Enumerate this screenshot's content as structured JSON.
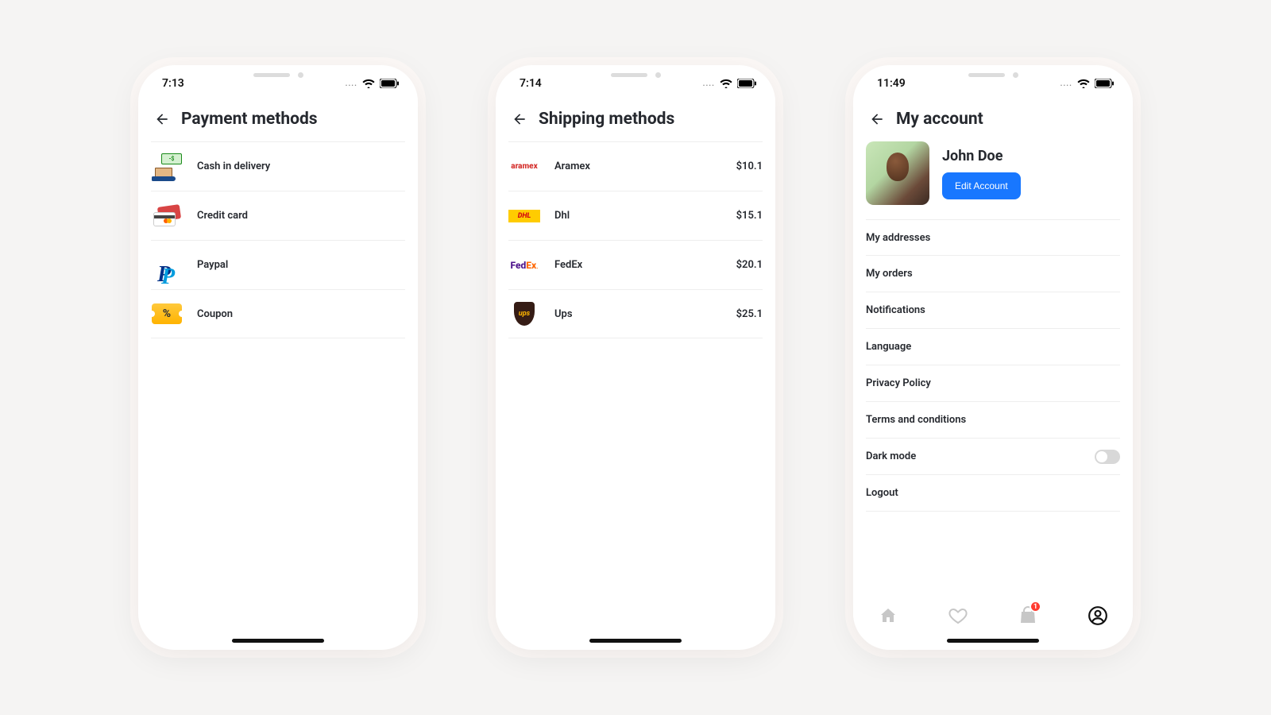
{
  "screens": {
    "payment": {
      "time": "7:13",
      "title": "Payment methods",
      "items": [
        {
          "label": "Cash in delivery"
        },
        {
          "label": "Credit card"
        },
        {
          "label": "Paypal"
        },
        {
          "label": "Coupon"
        }
      ]
    },
    "shipping": {
      "time": "7:14",
      "title": "Shipping methods",
      "items": [
        {
          "label": "Aramex",
          "price": "$10.1"
        },
        {
          "label": "Dhl",
          "price": "$15.1"
        },
        {
          "label": "FedEx",
          "price": "$20.1"
        },
        {
          "label": "Ups",
          "price": "$25.1"
        }
      ]
    },
    "account": {
      "time": "11:49",
      "title": "My account",
      "profile_name": "John Doe",
      "edit_label": "Edit Account",
      "items": [
        {
          "label": "My addresses"
        },
        {
          "label": "My orders"
        },
        {
          "label": "Notifications"
        },
        {
          "label": "Language"
        },
        {
          "label": "Privacy Policy"
        },
        {
          "label": "Terms and conditions"
        },
        {
          "label": "Dark mode",
          "toggle": true
        },
        {
          "label": "Logout"
        }
      ],
      "cart_badge": "1"
    }
  }
}
